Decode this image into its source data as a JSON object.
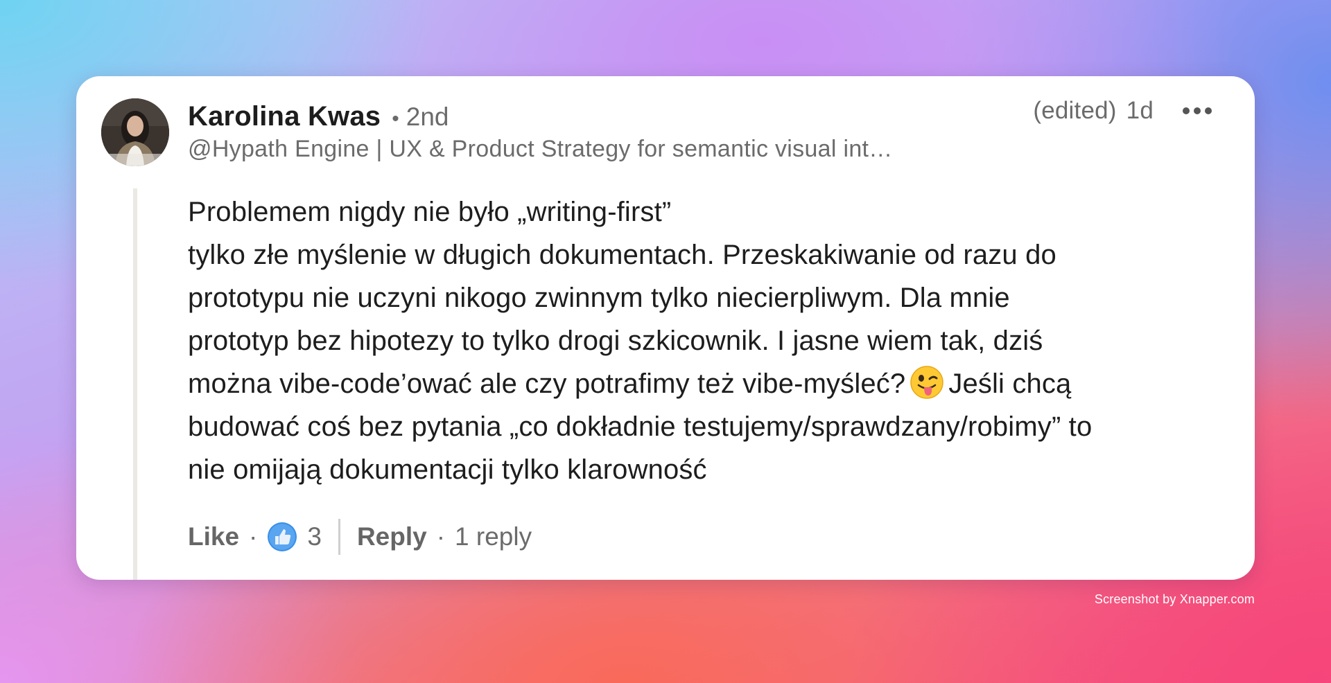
{
  "comment": {
    "author": {
      "name": "Karolina Kwas",
      "degree": "2nd",
      "headline": "@Hypath Engine | UX & Product Strategy for semantic visual int…"
    },
    "edited_label": "(edited)",
    "time": "1d",
    "body_lines": [
      "Problemem nigdy nie było „writing-first”",
      "tylko złe myślenie w długich dokumentach. Przeskakiwanie od razu do",
      "prototypu nie uczyni nikogo zwinnym tylko niecierpliwym. Dla mnie",
      "prototyp bez hipotezy to tylko drogi szkicownik. I jasne wiem tak, dziś",
      "można vibe-code’ować ale czy potrafimy też vibe-myśleć?",
      "Jeśli chcą",
      "budować coś bez pytania „co dokładnie testujemy/sprawdzany/robimy” to",
      "nie omijają dokumentacji tylko klarowność"
    ],
    "emoji": "winking-face-with-tongue-icon",
    "actions": {
      "like_label": "Like",
      "reaction_count": "3",
      "reply_label": "Reply",
      "reply_count_label": "1 reply"
    }
  },
  "watermark": "Screenshot by Xnapper.com",
  "colors": {
    "card_bg": "#ffffff",
    "text_primary": "#1d1d1d",
    "text_secondary": "#6b6b6b",
    "like_blue": "#378fe9"
  }
}
